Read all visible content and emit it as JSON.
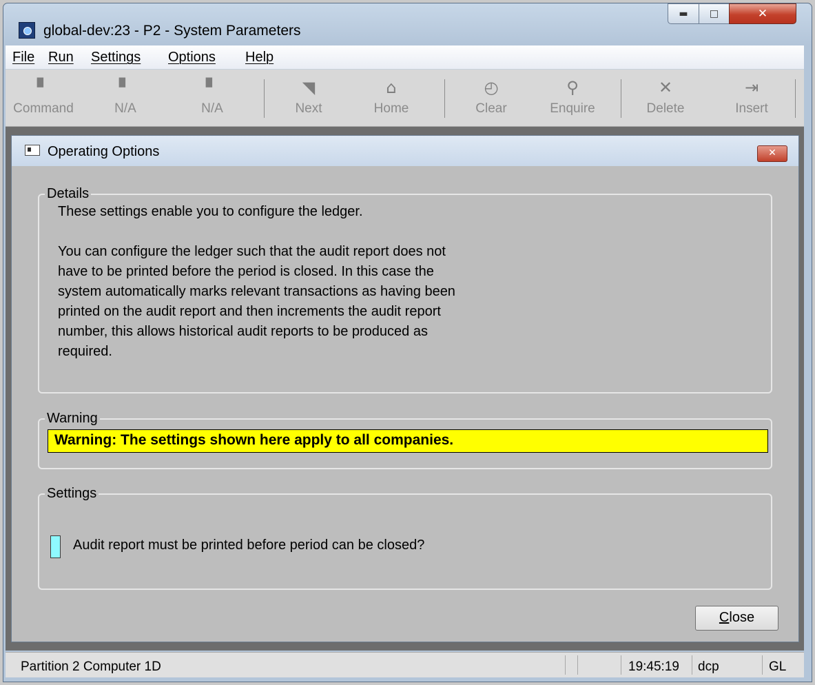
{
  "window": {
    "title": "global-dev:23 - P2 - System Parameters"
  },
  "menu": [
    "File",
    "Run",
    "Settings",
    "Options",
    "Help"
  ],
  "toolbar": [
    {
      "label": "Command",
      "icon": "f1-key-icon"
    },
    {
      "label": "N/A",
      "icon": "f2-key-icon"
    },
    {
      "label": "N/A",
      "icon": "f3-key-icon"
    },
    {
      "label": "Next",
      "icon": "next-page-icon"
    },
    {
      "label": "Home",
      "icon": "home-icon"
    },
    {
      "label": "Clear",
      "icon": "clear-icon"
    },
    {
      "label": "Enquire",
      "icon": "magnifier-icon"
    },
    {
      "label": "Delete",
      "icon": "delete-x-icon"
    },
    {
      "label": "Insert",
      "icon": "insert-icon"
    }
  ],
  "dialog": {
    "title": "Operating Options",
    "details": {
      "label": "Details",
      "para1": "These settings enable you to configure the ledger.",
      "para2_lines": [
        "You can configure the ledger such that the audit report does not",
        "have to be printed before the period is closed. In this case the",
        "system automatically marks relevant transactions as having been",
        "printed on the audit report and then increments the audit report",
        "number, this allows historical audit reports to be produced as",
        "required."
      ]
    },
    "warning": {
      "label": "Warning",
      "text": "Warning: The settings shown here apply to all companies."
    },
    "settings": {
      "label": "Settings",
      "audit_checkbox_label": "Audit report must be printed before period can be closed?",
      "audit_checked": false
    },
    "close_button": {
      "underlined": "C",
      "rest": "lose"
    }
  },
  "status": {
    "left": "Partition 2 Computer 1D",
    "time": "19:45:19",
    "user": "dcp",
    "module": "GL"
  },
  "colors": {
    "warning_bg": "#ffff00",
    "checkbox_bg": "#8ff9ff",
    "dialog_bg": "#bdbdbd"
  }
}
